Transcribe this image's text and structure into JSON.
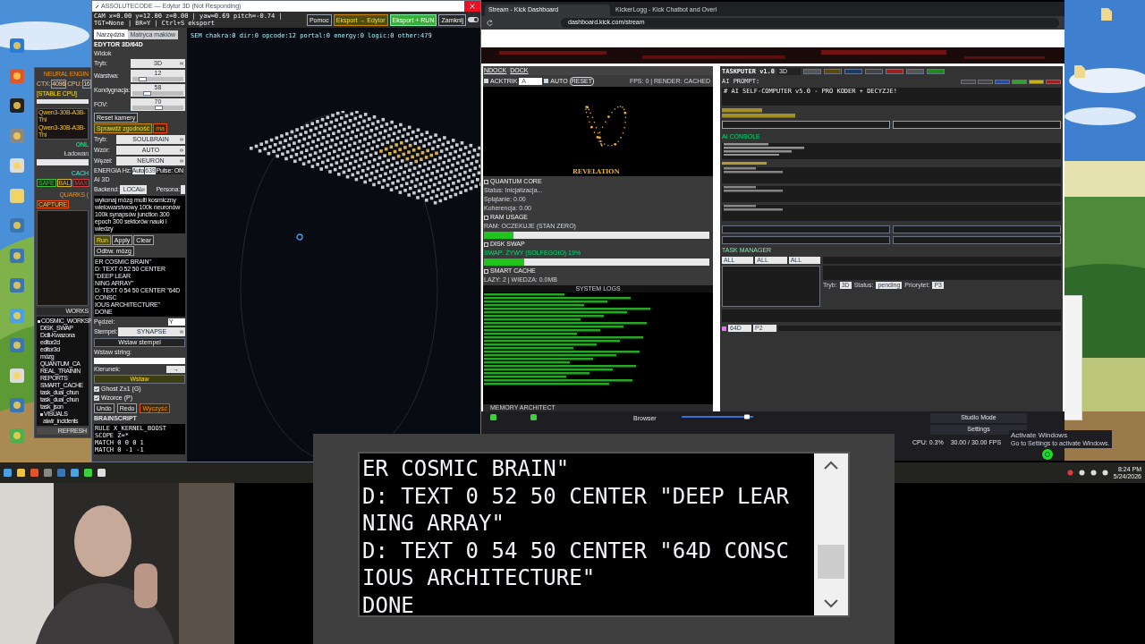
{
  "neural_window": {
    "title": "NEURAL ENGIN",
    "ctx_label": "CTX:",
    "ctx": "4096",
    "cpu_label": "CPU:",
    "cpu": "16",
    "tag": "[STABLE CPU]",
    "models": [
      "Qwen3-30B-A3B-Thi",
      "Qwen3-30B-A3B-Thi"
    ],
    "status": "ONL",
    "loading": "Ładowan",
    "cache": "CACH",
    "modes": [
      {
        "label": "SAFE",
        "color": "#3fbf3f"
      },
      {
        "label": "BAL",
        "color": "#d6b32a"
      },
      {
        "label": "MAX",
        "color": "#d04040"
      }
    ],
    "quarks": "QUARKS (",
    "capture": "CAPTURE",
    "workspace": "WORKS",
    "tree": [
      {
        "label": "COSMIC_WORKSP",
        "children": [
          {
            "label": "DISK_SWAP"
          },
          {
            "label": "Dcili-Kwazona"
          },
          {
            "label": "editor2d"
          },
          {
            "label": "editor3d"
          },
          {
            "label": "mózg"
          },
          {
            "label": "QUANTUM_CA"
          },
          {
            "label": "REAL_TRAININ"
          },
          {
            "label": "REPORTS"
          },
          {
            "label": "SMART_CACHE"
          },
          {
            "label": "task_dual_chun"
          },
          {
            "label": "task_dual_chun"
          },
          {
            "label": "task_json"
          },
          {
            "label": "VISUALS",
            "children": [
              {
                "label": "aiwir_incidents"
              }
            ]
          }
        ]
      }
    ],
    "refresh": "REFRESH"
  },
  "editor_window": {
    "title": "ASSOLUTECODE — Edytor 3D (Not Responding)",
    "status": "CAM x=0.00 y=12.00 z=0.00 | yaw=0.69 pitch=-0.74 | TGT=None | BR=Y | Ctrl+S eksport",
    "buttons": [
      {
        "label": "Pomoc",
        "kind": "plain"
      },
      {
        "label": "Eksport → Edytor",
        "kind": "yellow"
      },
      {
        "label": "Eksport + RUN",
        "kind": "green"
      },
      {
        "label": "Zamknij",
        "kind": "plain"
      }
    ],
    "toggle_on": true,
    "tabs": [
      {
        "label": "Narzędzia",
        "selected": true
      },
      {
        "label": "Matryca makiów",
        "selected": false
      }
    ],
    "panel_title": "EDYTOR 3D/64D",
    "view_group": "Widok",
    "view_rows": [
      {
        "kind": "select",
        "label": "Tryb:",
        "value": "3D"
      },
      {
        "kind": "slider",
        "label": "Warstwa:",
        "value": "12",
        "level": 0.2
      },
      {
        "kind": "slider",
        "label": "Kondygnacja:",
        "value": "58",
        "level": 0.28
      },
      {
        "kind": "slider",
        "label": "FOV:",
        "value": "70",
        "level": 0.5
      }
    ],
    "camera_buttons": [
      {
        "label": "Reset kamery",
        "kind": "plain"
      },
      {
        "label": "Sprawdź zgodność",
        "kind": "yellow"
      },
      {
        "label": "ma",
        "kind": "orange"
      }
    ],
    "selects": [
      {
        "label": "Tryb:",
        "value": "SOULBRAIN"
      },
      {
        "label": "Wzór:",
        "value": "AUTO"
      },
      {
        "label": "Węzeł:",
        "value": "NEURON"
      }
    ],
    "energy_label": "ENERGIA Hz:",
    "energy_auto": "Auto",
    "energy": "639",
    "pulse": "Pulse: ON",
    "ai_group": "AI 3D",
    "backend_label": "Backend:",
    "backend": "LOCAL",
    "persona_label": "Persona:",
    "prompt": "wykonaj mózg multi kosmiczny wielowarstwowy 100k neuronów 100k synapsów junction 300 epoch 300 sektorów nauki i wiedzy",
    "prompt_buttons": [
      {
        "label": "Run",
        "kind": "yellow"
      },
      {
        "label": "Apply",
        "kind": "plain"
      },
      {
        "label": "Clear",
        "kind": "plain"
      },
      {
        "label": "Odbw. mózg",
        "kind": "plain"
      }
    ],
    "output_lines": [
      "ER COSMIC BRAIN\"",
      "D: TEXT 0 52 50 CENTER \"DEEP LEAR",
      "NING ARRAY\"",
      "D: TEXT 0 54 50 CENTER \"64D CONSC",
      "IOUS ARCHITECTURE\"",
      "DONE"
    ],
    "brush_label": "Pędzel:",
    "brush": "Y",
    "stamp_label": "Stempel:",
    "stamp": "SYNAPSE",
    "stamp_button": "Wstaw stempel",
    "string_label": "Wstaw string:",
    "direction_label": "Kierunek:",
    "direction": "→",
    "insert_button": "Wstaw",
    "checks": [
      {
        "label": "Ghost Z±1 (G)",
        "checked": true
      },
      {
        "label": "Wzorce (P)",
        "checked": true
      }
    ],
    "history_buttons": [
      {
        "label": "Undo",
        "kind": "plain"
      },
      {
        "label": "Redo",
        "kind": "plain"
      },
      {
        "label": "Wyczyść",
        "kind": "orange"
      }
    ],
    "script_title": "BRAINSCRIPT",
    "script_lines": [
      "RULE X_KERNEL_BOOST",
      "SCOPE Z=*",
      "MATCH 0 0 0 1",
      "MATCH 0 -1 -1"
    ],
    "canvas_stats": "SEM chakra:0 dir:0 opcode:12 portal:0 energy:0 logic:0 other:479"
  },
  "browser": {
    "tabs": [
      {
        "label": "Stream - Kick Dashboard",
        "selected": true
      },
      {
        "label": "KickerLogg - Kick Chatbot and Overl",
        "selected": false
      }
    ],
    "url": "dashboard.kick.com/stream",
    "visual_panel": {
      "dock_buttons": [
        "NDOCK",
        "DOCK"
      ],
      "acktrik": {
        "label": "ACKTRIK",
        "checked": true
      },
      "select": "A",
      "auto": {
        "label": "AUTO",
        "checked": true
      },
      "reset": "RESET",
      "fps": "FPS: 0 | RENDER: CACHED",
      "caption": "REVELATION",
      "sections": [
        {
          "kind": "text",
          "title": "QUANTUM CORE",
          "lines": [
            "Status: Inicjalizacja...",
            "Splątanie: 0.00",
            "Koherencja: 0.00"
          ]
        },
        {
          "kind": "meter",
          "title": "RAM USAGE",
          "reading": "RAM: OCZEKUJE (STAN ZERO)",
          "active": false,
          "level": 0.13
        },
        {
          "kind": "meter",
          "title": "DISK SWAP",
          "reading": "SWAP: ŻYWY (SOLFEGGIO) 19%",
          "active": true,
          "level": 0.18
        },
        {
          "kind": "text",
          "title": "SMART CACHE",
          "lines": [
            "LAZY: 2 | WIEDZA: 0.0MB"
          ]
        }
      ],
      "logs_title": "SYSTEM LOGS",
      "footer": "MEMORY ARCHITECT"
    },
    "taskputer": {
      "title": "TASKPUTER v1.0",
      "mode": "3D",
      "prompt_label": "AI PROMPT:",
      "prompt": "# AI SELF-COMPUTER v5.0 - PRO KODER + DECYZJE!",
      "console_label": "AI CONSOLE",
      "manager_label": "TASK MANAGER",
      "filters": [
        "ALL",
        "ALL",
        "ALL"
      ],
      "task_fields": [
        {
          "label": "Tryb:",
          "value": "3D"
        },
        {
          "label": "Status:",
          "value": "pending"
        },
        {
          "label": "Priorytet:",
          "value": "P3"
        }
      ],
      "bottom_checked": true,
      "bottom_selects": [
        "64D",
        "P2"
      ]
    }
  },
  "obs": {
    "dock_label": "Browser",
    "buttons": [
      "Studio Mode",
      "Settings"
    ],
    "cpu": "CPU: 0.3%",
    "fps": "30.00 / 30.00 FPS"
  },
  "zoom_window": {
    "lines": [
      "ER COSMIC BRAIN\"",
      "D: TEXT 0 52 50 CENTER \"DEEP LEAR",
      "NING ARRAY\"",
      "D: TEXT 0 54 50 CENTER \"64D CONSC",
      "IOUS ARCHITECTURE\"",
      "DONE"
    ]
  },
  "activation": {
    "title": "Activate Windows",
    "hint": "Go to Settings to activate Windows."
  },
  "clock": {
    "time": "8:24 PM",
    "date": "5/24/2026"
  }
}
